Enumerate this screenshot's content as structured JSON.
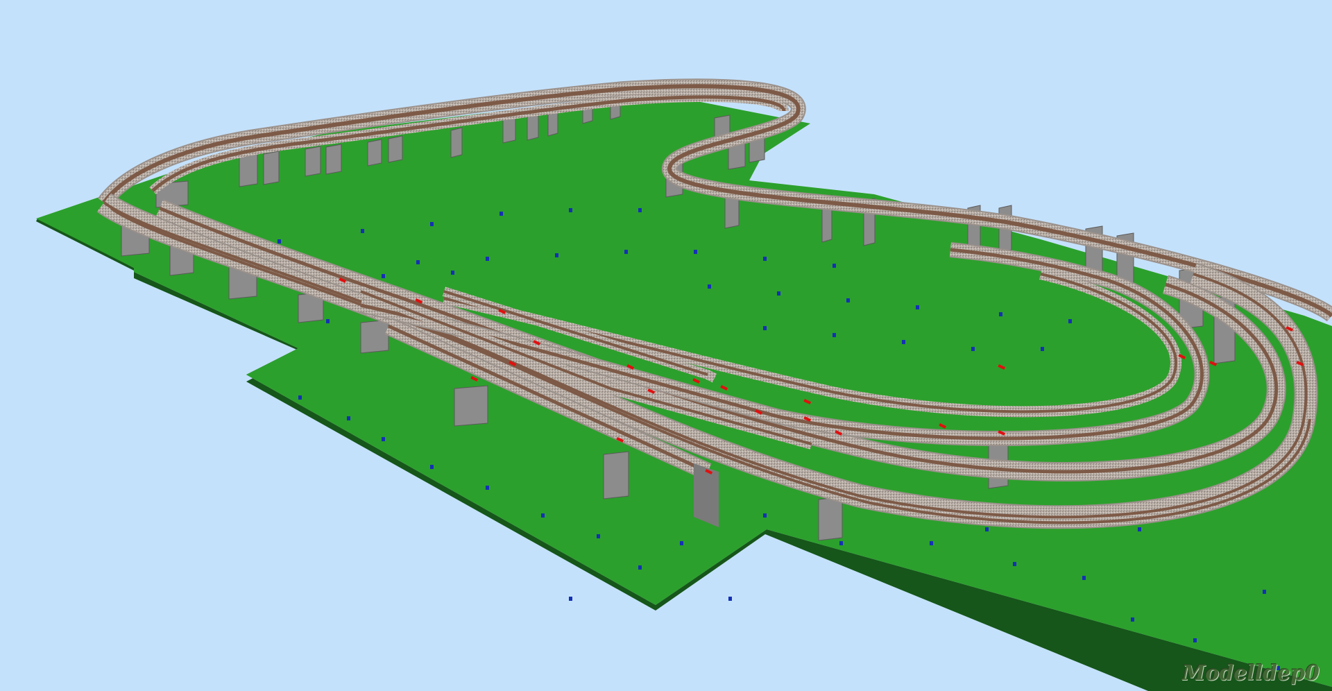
{
  "scene": {
    "background_color": "#c4e1fb",
    "baseboard_color": "#2ca02c",
    "baseboard_edge_color": "#16561a",
    "pier_color": "#8c8c8c",
    "ballast_color": "#b4aaa3",
    "rail_color": "#7d5a47",
    "marker_color": "#1430b4",
    "signal_color": "#e01010"
  },
  "watermark": {
    "text": "Modelldep0"
  }
}
